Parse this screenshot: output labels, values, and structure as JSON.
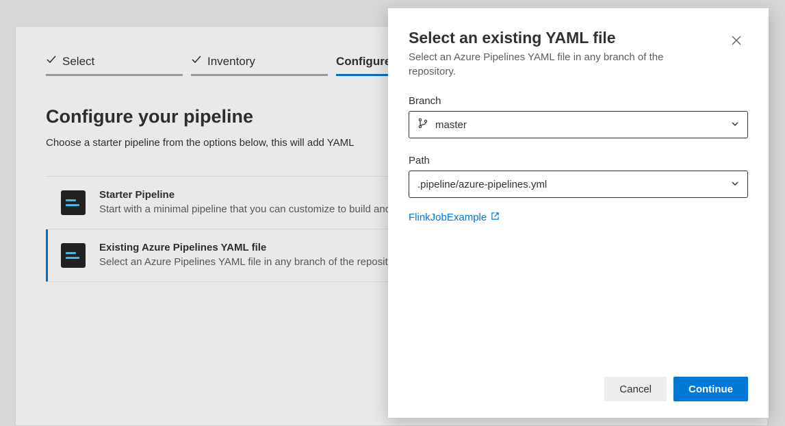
{
  "stepper": {
    "select": "Select",
    "inventory": "Inventory",
    "configure": "Configure"
  },
  "page": {
    "title": "Configure your pipeline",
    "subtitle": "Choose a starter pipeline from the options below, this will add YAML"
  },
  "options": {
    "starter": {
      "title": "Starter Pipeline",
      "desc": "Start with a minimal pipeline that you can customize to build and deploy your code."
    },
    "existing": {
      "title": "Existing Azure Pipelines YAML file",
      "desc": "Select an Azure Pipelines YAML file in any branch of the repository."
    }
  },
  "panel": {
    "title": "Select an existing YAML file",
    "subtitle": "Select an Azure Pipelines YAML file in any branch of the repository.",
    "branchLabel": "Branch",
    "branchValue": "master",
    "pathLabel": "Path",
    "pathValue": ".pipeline/azure-pipelines.yml",
    "repoLink": "FlinkJobExample",
    "cancel": "Cancel",
    "continue": "Continue"
  }
}
